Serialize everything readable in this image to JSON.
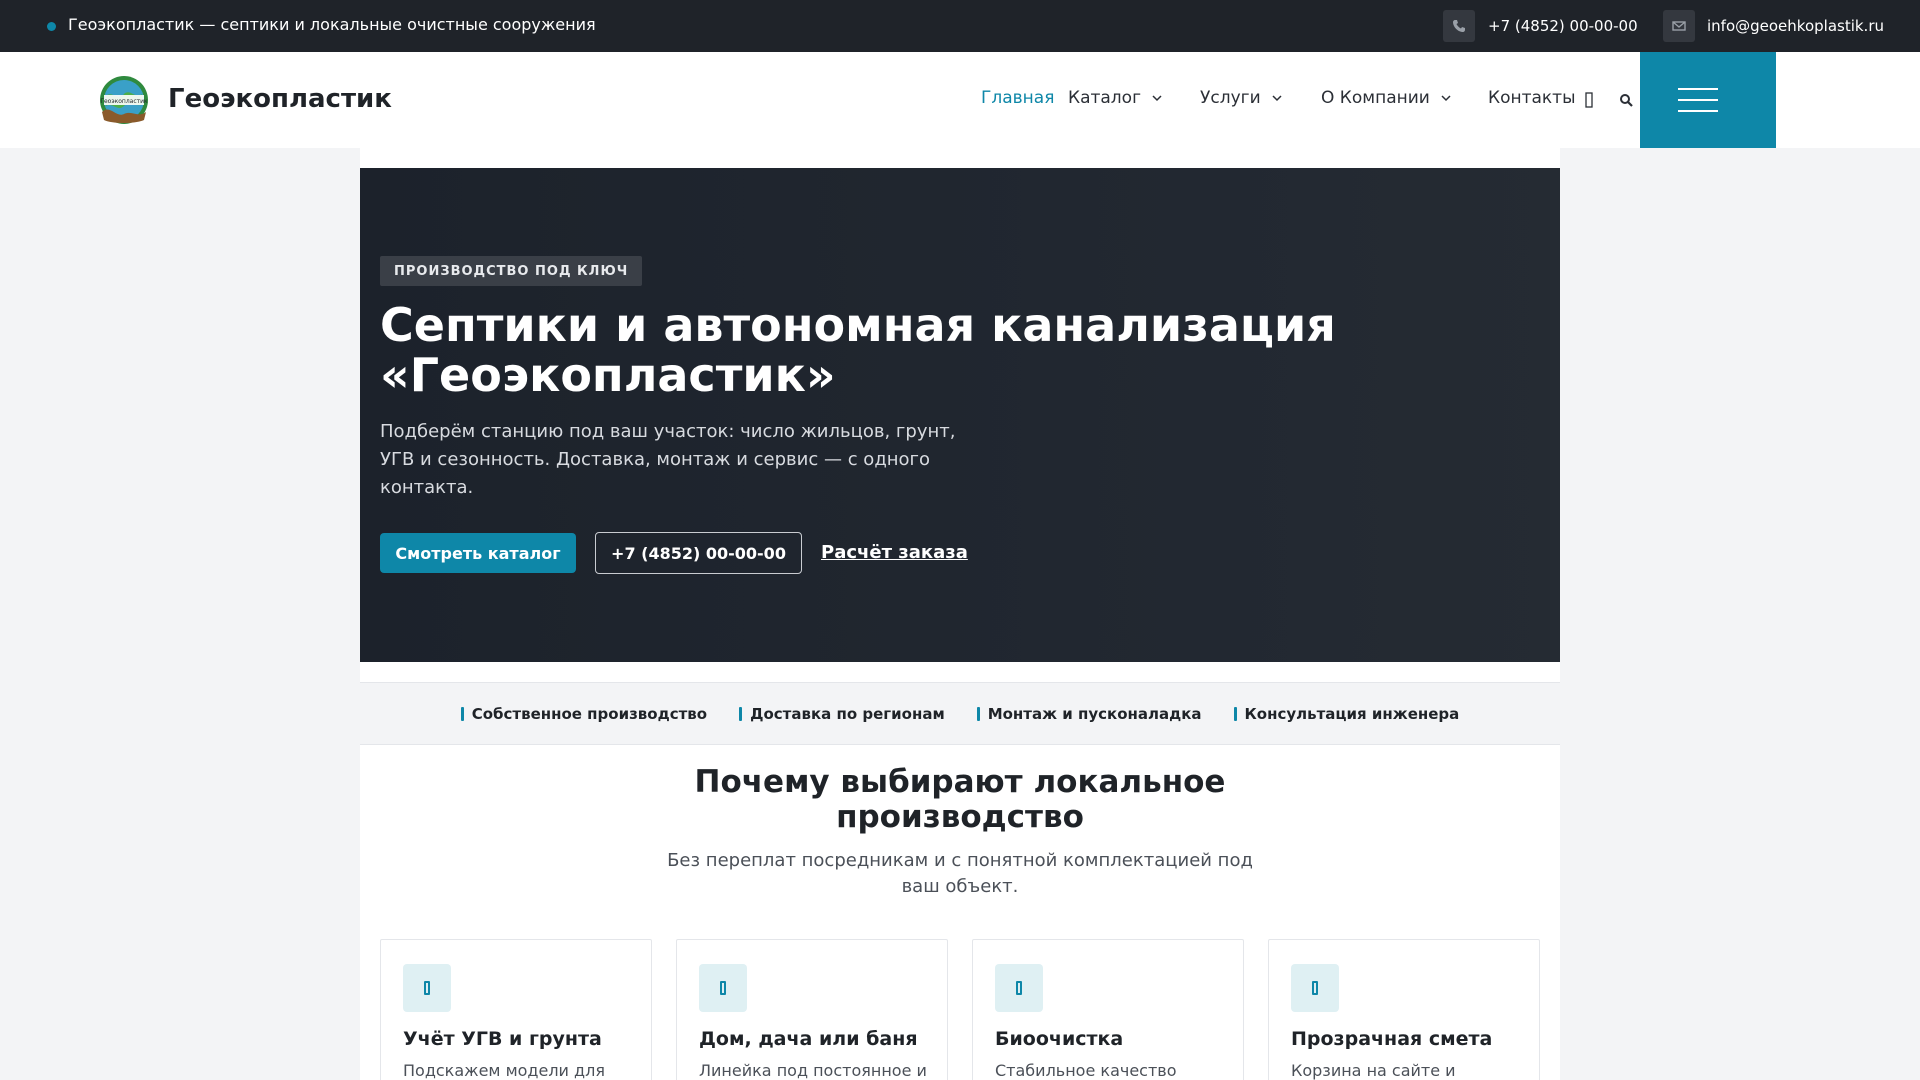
{
  "topbar": {
    "tagline": "Геоэкопластик — септики и локальные очистные сооружения",
    "phone": "+7 (4852) 00-00-00",
    "email": "info@geoehkoplastik.ru"
  },
  "header": {
    "brand": "Геоэкопластик",
    "logo_text": "Геоэкопластик",
    "nav": {
      "home": "Главная",
      "catalog": "Каталог",
      "services": "Услуги",
      "about": "О Компании",
      "contacts": "Контакты"
    }
  },
  "hero": {
    "badge": "ПРОИЗВОДСТВО ПОД КЛЮЧ",
    "title": "Септики и автономная канализация «Геоэкопластик»",
    "lead": "Подберём станцию под ваш участок: число жильцов, грунт, УГВ и сезонность. Доставка, монтаж и сервис — с одного контакта.",
    "btn_catalog": "Смотреть каталог",
    "btn_phone": "+7 (4852) 00-00-00",
    "link_calc": "Расчёт заказа"
  },
  "features": [
    "Собственное производство",
    "Доставка по регионам",
    "Монтаж и пусконаладка",
    "Консультация инженера"
  ],
  "why": {
    "title": "Почему выбирают локальное производство",
    "subtitle": "Без переплат посредникам и с понятной комплектацией под ваш объект.",
    "cards": [
      {
        "title": "Учёт УГВ и грунта",
        "text": "Подскажем модели для"
      },
      {
        "title": "Дом, дача или баня",
        "text": "Линейка под постоянное и"
      },
      {
        "title": "Биоочистка",
        "text": "Стабильное качество"
      },
      {
        "title": "Прозрачная смета",
        "text": "Корзина на сайте и"
      }
    ]
  },
  "colors": {
    "accent": "#0e87a8",
    "topbar_bg": "#1f2329",
    "hero_bg": "#1c222b"
  }
}
